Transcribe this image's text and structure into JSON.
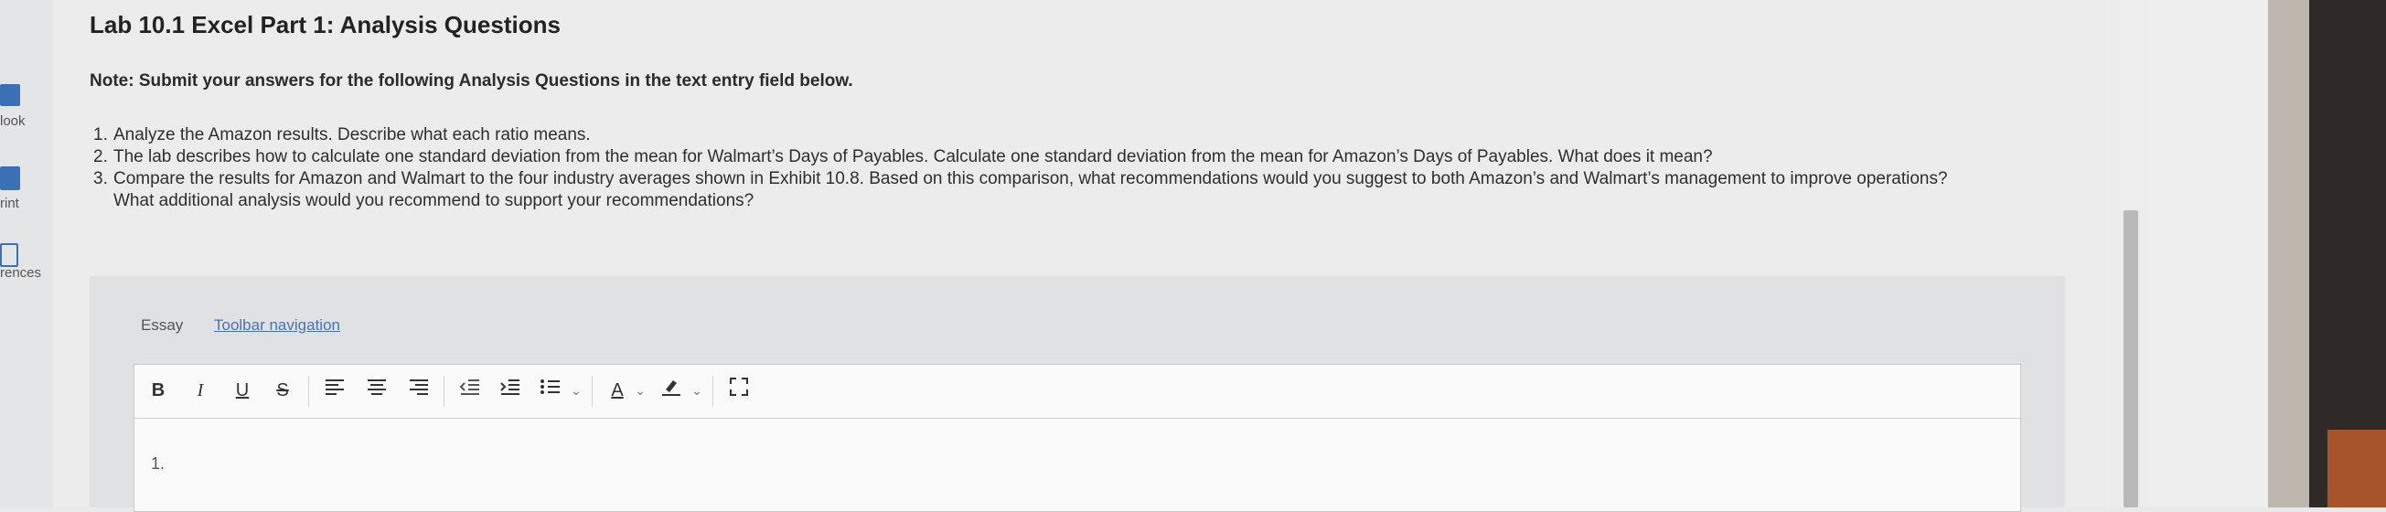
{
  "sidebar": {
    "items": [
      {
        "label": "look",
        "icon": "book-icon"
      },
      {
        "label": "rint",
        "icon": "print-icon"
      },
      {
        "label": "rences",
        "icon": "references-icon"
      }
    ]
  },
  "page": {
    "title": "Lab 10.1 Excel Part 1: Analysis Questions",
    "note": "Note: Submit your answers for the following Analysis Questions in the text entry field below.",
    "questions": [
      {
        "num": "1.",
        "text": "Analyze the Amazon results. Describe what each ratio means."
      },
      {
        "num": "2.",
        "text": "The lab describes how to calculate one standard deviation from the mean for Walmart’s Days of Payables. Calculate one standard deviation from the mean for Amazon’s Days of Payables. What does it mean?"
      },
      {
        "num": "3.",
        "text": "Compare the results for Amazon and Walmart to the four industry averages shown in Exhibit 10.8. Based on this comparison, what recommendations would you suggest to both Amazon’s and Walmart’s management to improve operations? What additional analysis would you recommend to support your recommendations?"
      }
    ]
  },
  "essay": {
    "label": "Essay",
    "toolbar_link": "Toolbar navigation",
    "toolbar": {
      "bold": "B",
      "italic": "I",
      "underline": "U",
      "strike": "S",
      "font_color": "A"
    },
    "editor_line": "1."
  }
}
